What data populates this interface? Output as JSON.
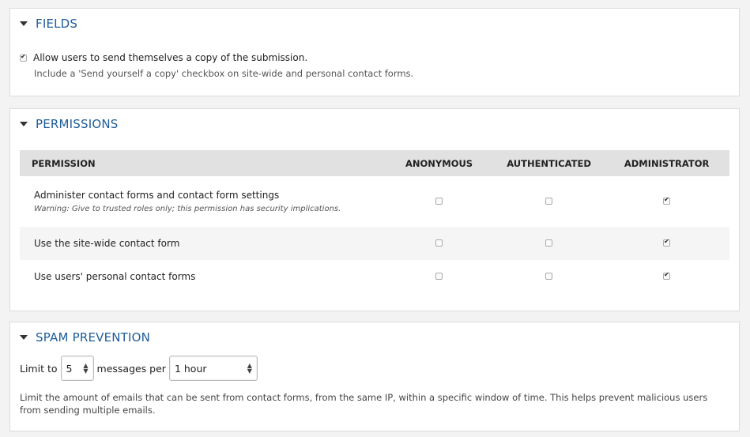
{
  "fields": {
    "legend": "FIELDS",
    "copy_checkbox_label": "Allow users to send themselves a copy of the submission.",
    "copy_checkbox_checked": true,
    "copy_description": "Include a 'Send yourself a copy' checkbox on site-wide and personal contact forms."
  },
  "permissions": {
    "legend": "PERMISSIONS",
    "columns": [
      "PERMISSION",
      "ANONYMOUS",
      "AUTHENTICATED",
      "ADMINISTRATOR"
    ],
    "rows": [
      {
        "name": "Administer contact forms and contact form settings",
        "warning": "Warning: Give to trusted roles only; this permission has security implications.",
        "anonymous": false,
        "authenticated": false,
        "administrator": true
      },
      {
        "name": "Use the site-wide contact form",
        "anonymous": false,
        "authenticated": false,
        "administrator": true
      },
      {
        "name": "Use users' personal contact forms",
        "anonymous": false,
        "authenticated": false,
        "administrator": true
      }
    ]
  },
  "spam": {
    "legend": "SPAM PREVENTION",
    "limit_label": "Limit to",
    "limit_value": "5",
    "messages_per_label": "messages per",
    "window_value": "1 hour",
    "description": "Limit the amount of emails that can be sent from contact forms, from the same IP, within a specific window of time. This helps prevent malicious users from sending multiple emails."
  },
  "colors": {
    "legend_text": "#1e5c99",
    "header_bg": "#e1e1e1",
    "page_bg": "#f3f3f3"
  }
}
